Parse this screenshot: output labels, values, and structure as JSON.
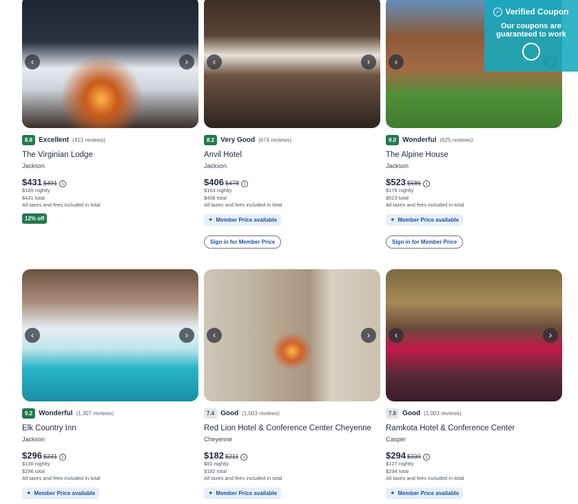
{
  "coupon": {
    "title": "Verified Coupon",
    "text": "Our coupons are guaranteed to work"
  },
  "hotels": [
    {
      "score": "8.8",
      "rating": "Excellent",
      "reviews": "(413 reviews)",
      "name": "The Virginian Lodge",
      "location": "Jackson",
      "price": "$431",
      "old_price": "$491",
      "nightly": "$169 nightly",
      "total": "$431 total",
      "taxes": "All taxes and fees included in total",
      "discount": "12% off"
    },
    {
      "score": "8.2",
      "rating": "Very Good",
      "reviews": "(674 reviews)",
      "name": "Anvil Hotel",
      "location": "Jackson",
      "price": "$406",
      "old_price": "$478",
      "nightly": "$163 nightly",
      "total": "$406 total",
      "taxes": "All taxes and fees included in total",
      "member": "Member Price available",
      "signin": "Sign in for Member Price"
    },
    {
      "score": "9.0",
      "rating": "Wonderful",
      "reviews": "(625 reviews)",
      "name": "The Alpine House",
      "location": "Jackson",
      "price": "$523",
      "old_price": "$586",
      "nightly": "$178 nightly",
      "total": "$523 total",
      "taxes": "All taxes and fees included in total",
      "member": "Member Price available",
      "signin": "Sign in for Member Price"
    },
    {
      "score": "9.2",
      "rating": "Wonderful",
      "reviews": "(1,307 reviews)",
      "name": "Elk Country Inn",
      "location": "Jackson",
      "price": "$296",
      "old_price": "$331",
      "nightly": "$130 nightly",
      "total": "$296 total",
      "taxes": "All taxes and fees included in total",
      "member": "Member Price available"
    },
    {
      "score": "7.4",
      "rating": "Good",
      "reviews": "(1,003 reviews)",
      "name": "Red Lion Hotel & Conference Center Cheyenne",
      "location": "Cheyenne",
      "price": "$182",
      "old_price": "$211",
      "nightly": "$81 nightly",
      "total": "$182 total",
      "taxes": "All taxes and fees included in total",
      "member": "Member Price available"
    },
    {
      "score": "7.8",
      "rating": "Good",
      "reviews": "(1,003 reviews)",
      "name": "Ramkota Hotel & Conference Center",
      "location": "Casper",
      "price": "$294",
      "old_price": "$330",
      "nightly": "$127 nightly",
      "total": "$294 total",
      "taxes": "All taxes and fees included in total",
      "member": "Member Price available"
    }
  ],
  "icons": {
    "prev": "‹",
    "next": "›",
    "info": "i",
    "member": "✦",
    "check": "✓"
  },
  "colors": {
    "score_green": "#227950",
    "score_grey": "#e3e6eb",
    "member_bg": "#e7f0fa",
    "coupon_bg": "#16aabe"
  }
}
